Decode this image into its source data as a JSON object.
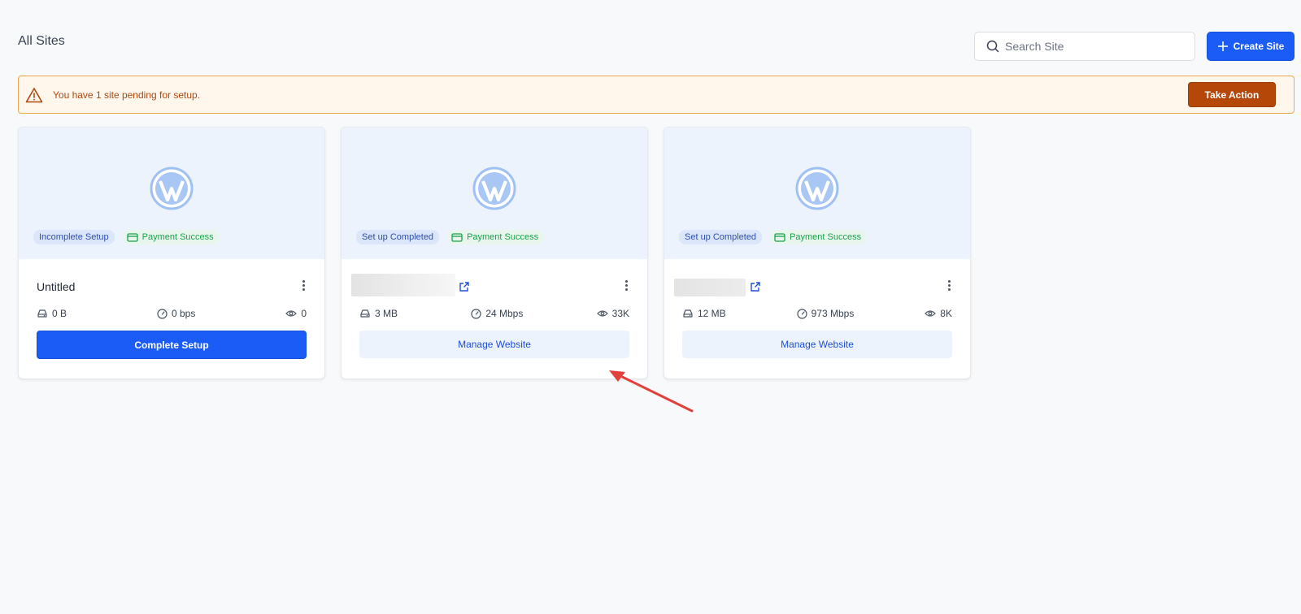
{
  "header": {
    "title": "All Sites",
    "search_placeholder": "Search Site",
    "create_label": "Create Site"
  },
  "alert": {
    "message": "You have 1 site pending for setup.",
    "action_label": "Take Action"
  },
  "sites": [
    {
      "status": "Incomplete Setup",
      "payment": "Payment Success",
      "name": "Untitled",
      "storage": "0 B",
      "bandwidth": "0 bps",
      "views": "0",
      "action_label": "Complete Setup"
    },
    {
      "status": "Set up Completed",
      "payment": "Payment Success",
      "name": "",
      "storage": "3 MB",
      "bandwidth": "24 Mbps",
      "views": "33K",
      "action_label": "Manage Website"
    },
    {
      "status": "Set up Completed",
      "payment": "Payment Success",
      "name": "",
      "storage": "12 MB",
      "bandwidth": "973 Mbps",
      "views": "8K",
      "action_label": "Manage Website"
    }
  ],
  "icons": {
    "search": "search-icon",
    "plus": "plus-icon",
    "warning": "warning-icon",
    "wordpress": "wordpress-logo",
    "card": "credit-card-icon",
    "external": "external-link-icon",
    "menu": "kebab-menu-icon",
    "storage": "hard-drive-icon",
    "speed": "gauge-icon",
    "views": "eye-icon"
  },
  "colors": {
    "primary": "#1a5cf5",
    "warning_bg": "#fff7ec",
    "warning_border": "#f2a64b",
    "warning_text": "#b0470d",
    "warning_button": "#b54708",
    "success": "#17a34a",
    "hero_bg": "#edf3fd",
    "annotation_arrow": "#e0413a"
  }
}
